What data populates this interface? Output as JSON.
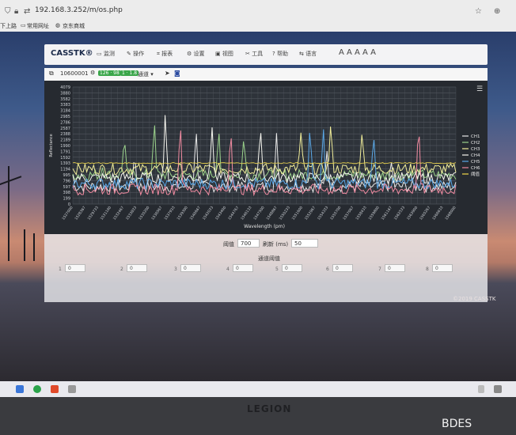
{
  "browser": {
    "address": "192.168.3.252/m/os.php",
    "bookmarks": [
      "下上路",
      "常用网址",
      "京东商城"
    ]
  },
  "app": {
    "brand": "CASSTK®",
    "menu": [
      "监测",
      "操作",
      "报表",
      "设置",
      "视图",
      "工具",
      "帮助",
      "语言"
    ],
    "font_sizes": "A A A A A",
    "device_id": "10600001",
    "badge_1": "126 · 98",
    "badge_2": "1 · 1.8",
    "channel_select": "通道 ▾",
    "threshold_label": "阈值",
    "threshold_value": "700",
    "refresh_label": "刷新 (ms)",
    "refresh_value": "50",
    "channel_threshold_label": "通道阈值",
    "channels": [
      {
        "label": "1",
        "value": "0"
      },
      {
        "label": "2",
        "value": "0"
      },
      {
        "label": "3",
        "value": "0"
      },
      {
        "label": "4",
        "value": "0"
      },
      {
        "label": "5",
        "value": "0"
      },
      {
        "label": "6",
        "value": "0"
      },
      {
        "label": "7",
        "value": "0"
      },
      {
        "label": "8",
        "value": "0"
      }
    ],
    "copyright": "©2019 CASSTK"
  },
  "chart_data": {
    "type": "line",
    "xlabel": "Wavelength (pm)",
    "ylabel": "Reflectance",
    "ylim": [
      0,
      4000
    ],
    "yticks": [
      4079,
      3880,
      3582,
      3383,
      3184,
      2985,
      2786,
      2587,
      2388,
      2189,
      1990,
      1791,
      1592,
      1393,
      1194,
      995,
      796,
      597,
      398,
      199,
      0
    ],
    "x_range": [
      1527000,
      1568000
    ],
    "legend_placement": "right",
    "series": [
      {
        "name": "CH1",
        "color": "#e8e8e8",
        "peaks": [
          [
            1533600,
            1700
          ],
          [
            1540200,
            2600
          ],
          [
            1548800,
            2300
          ],
          [
            1554200,
            1900
          ],
          [
            1561100,
            1400
          ]
        ],
        "base": 600
      },
      {
        "name": "CH2",
        "color": "#9ad18a",
        "peaks": [
          [
            1530200,
            1300
          ],
          [
            1532500,
            2250
          ],
          [
            1535700,
            2700
          ],
          [
            1542600,
            2600
          ],
          [
            1545300,
            2300
          ]
        ],
        "base": 1000
      },
      {
        "name": "CH3",
        "color": "#f2ee9a",
        "peaks": [
          [
            1551400,
            2350
          ],
          [
            1554600,
            2600
          ],
          [
            1558000,
            2450
          ]
        ],
        "base": 1200
      },
      {
        "name": "CH4",
        "color": "#f7f7f0",
        "peaks": [
          [
            1536900,
            2900
          ],
          [
            1541900,
            2750
          ],
          [
            1547100,
            2650
          ]
        ],
        "base": 900
      },
      {
        "name": "CH5",
        "color": "#5aa8e8",
        "peaks": [
          [
            1552400,
            2750
          ],
          [
            1553800,
            2600
          ],
          [
            1559200,
            2400
          ]
        ],
        "base": 700
      },
      {
        "name": "CH6",
        "color": "#f08aa0",
        "peaks": [
          [
            1538500,
            2800
          ],
          [
            1543900,
            2650
          ],
          [
            1564000,
            2550
          ]
        ],
        "base": 500
      },
      {
        "name": "阈值",
        "color": "#f1d84a",
        "peaks": [],
        "base": 1400
      }
    ]
  }
}
